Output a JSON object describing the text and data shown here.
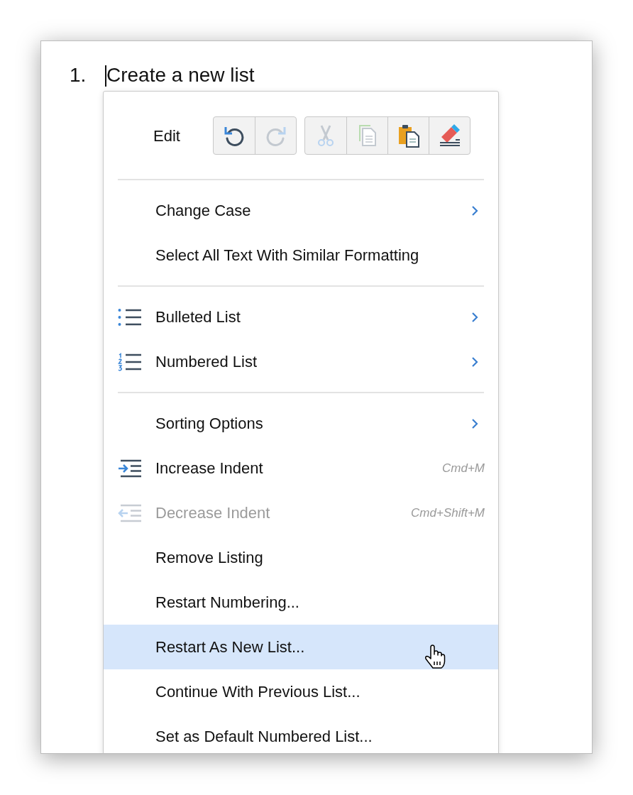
{
  "document": {
    "list_number": "1.",
    "list_text": "Create a new list"
  },
  "context_menu": {
    "edit_row": {
      "label": "Edit",
      "groups": [
        [
          {
            "kind": "undo",
            "disabled": false
          },
          {
            "kind": "redo",
            "disabled": true
          }
        ],
        [
          {
            "kind": "cut",
            "disabled": true
          },
          {
            "kind": "copy",
            "disabled": true
          },
          {
            "kind": "paste",
            "disabled": false
          },
          {
            "kind": "clear_format",
            "disabled": false
          }
        ]
      ]
    },
    "sections": [
      [
        {
          "label": "Change Case",
          "submenu": true,
          "disabled": false,
          "selected": false
        },
        {
          "label": "Select All Text With Similar Formatting",
          "submenu": false,
          "disabled": false,
          "selected": false
        }
      ],
      [
        {
          "kind": "bulleted",
          "label": "Bulleted List",
          "submenu": true,
          "disabled": false,
          "selected": false
        },
        {
          "kind": "numbered",
          "label": "Numbered List",
          "submenu": true,
          "disabled": false,
          "selected": false
        }
      ],
      [
        {
          "label": "Sorting Options",
          "submenu": true,
          "disabled": false,
          "selected": false
        },
        {
          "kind": "indent",
          "label": "Increase Indent",
          "shortcut": "Cmd+M",
          "submenu": false,
          "disabled": false,
          "selected": false
        },
        {
          "kind": "outdent",
          "label": "Decrease Indent",
          "shortcut": "Cmd+Shift+M",
          "submenu": false,
          "disabled": true,
          "selected": false
        },
        {
          "label": "Remove Listing",
          "submenu": false,
          "disabled": false,
          "selected": false
        },
        {
          "label": "Restart Numbering...",
          "submenu": false,
          "disabled": false,
          "selected": false
        },
        {
          "label": "Restart As New List...",
          "submenu": false,
          "disabled": false,
          "selected": true
        },
        {
          "label": "Continue With Previous List...",
          "submenu": false,
          "disabled": false,
          "selected": false
        },
        {
          "label": "Set as Default Numbered List...",
          "submenu": false,
          "disabled": false,
          "selected": false
        }
      ]
    ]
  }
}
